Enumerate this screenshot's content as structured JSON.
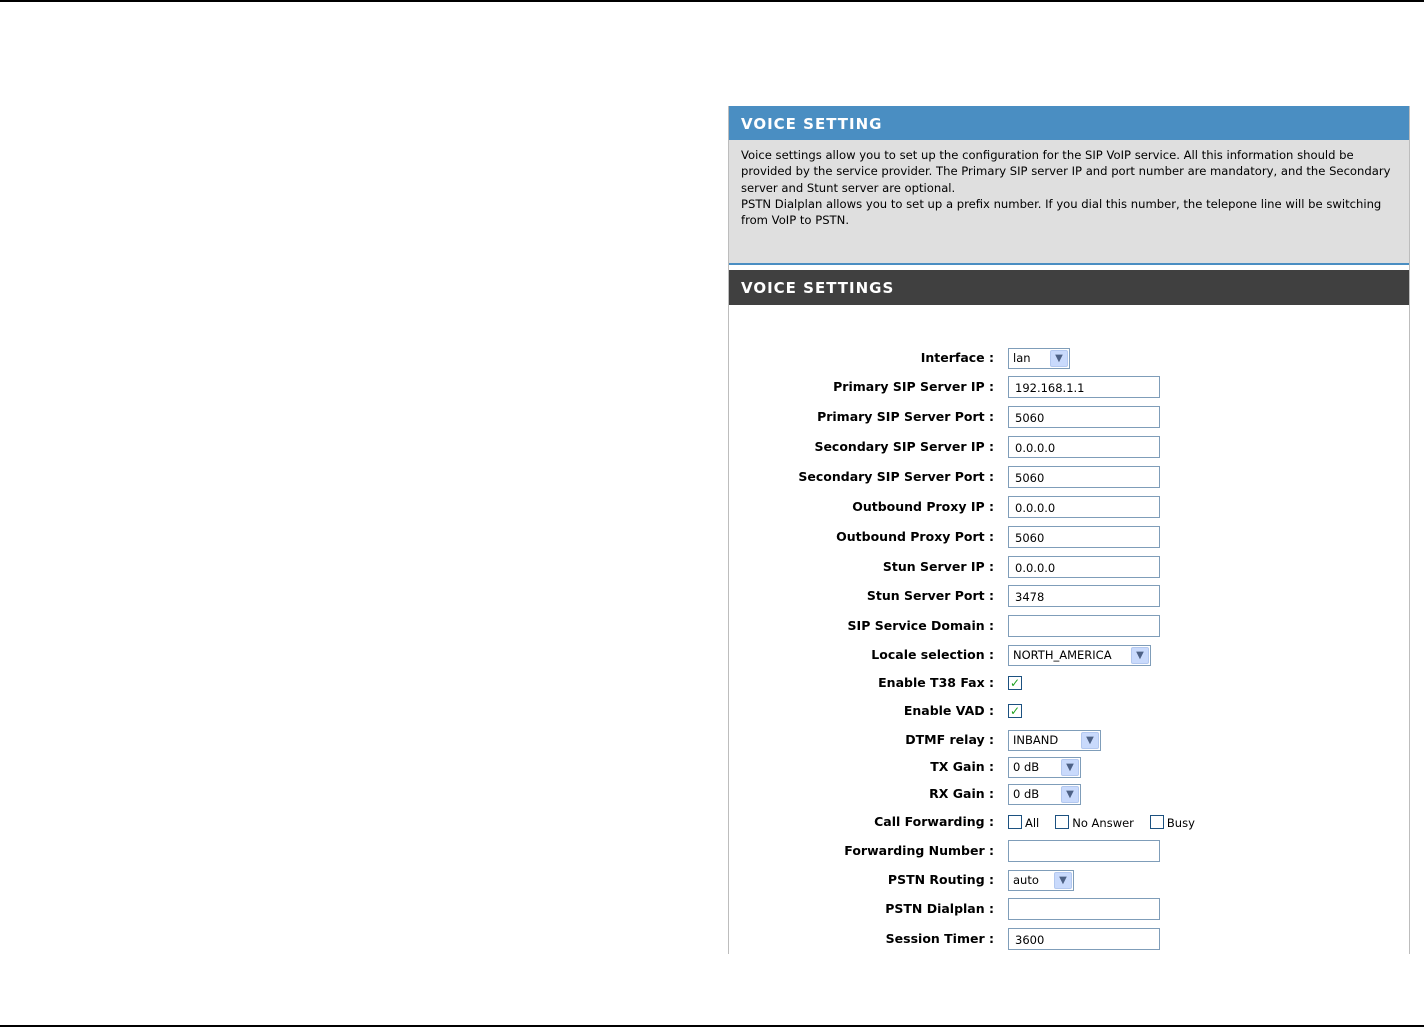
{
  "info": {
    "title": "VOICE SETTING",
    "description_1": "Voice settings allow you to set up the configuration for the SIP VoIP service. All this information should be provided by the service provider. The Primary SIP server IP and port number are mandatory, and the Secondary server and Stunt server are optional.",
    "description_2": "PSTN Dialplan allows you to set up a prefix number. If you dial this number, the telepone line will be switching from VoIP to PSTN."
  },
  "settings": {
    "title": "VOICE SETTINGS",
    "interface": {
      "label": "Interface :",
      "value": "lan"
    },
    "primary_sip_ip": {
      "label": "Primary SIP Server IP :",
      "value": "192.168.1.1"
    },
    "primary_sip_port": {
      "label": "Primary SIP Server Port :",
      "value": "5060"
    },
    "secondary_sip_ip": {
      "label": "Secondary SIP Server IP :",
      "value": "0.0.0.0"
    },
    "secondary_sip_port": {
      "label": "Secondary SIP Server Port :",
      "value": "5060"
    },
    "outbound_proxy_ip": {
      "label": "Outbound Proxy IP :",
      "value": "0.0.0.0"
    },
    "outbound_proxy_port": {
      "label": "Outbound Proxy Port :",
      "value": "5060"
    },
    "stun_server_ip": {
      "label": "Stun Server IP :",
      "value": "0.0.0.0"
    },
    "stun_server_port": {
      "label": "Stun Server Port :",
      "value": "3478"
    },
    "sip_service_domain": {
      "label": "SIP Service Domain :",
      "value": ""
    },
    "locale_selection": {
      "label": "Locale selection :",
      "value": "NORTH_AMERICA"
    },
    "enable_t38_fax": {
      "label": "Enable T38 Fax :",
      "checked": true
    },
    "enable_vad": {
      "label": "Enable VAD :",
      "checked": true
    },
    "dtmf_relay": {
      "label": "DTMF relay :",
      "value": "INBAND"
    },
    "tx_gain": {
      "label": "TX Gain :",
      "value": "0 dB"
    },
    "rx_gain": {
      "label": "RX Gain :",
      "value": "0 dB"
    },
    "call_forwarding": {
      "label": "Call Forwarding :",
      "options": [
        {
          "label": "All",
          "checked": false
        },
        {
          "label": "No Answer",
          "checked": false
        },
        {
          "label": "Busy",
          "checked": false
        }
      ]
    },
    "forwarding_number": {
      "label": "Forwarding Number :",
      "value": ""
    },
    "pstn_routing": {
      "label": "PSTN Routing :",
      "value": "auto"
    },
    "pstn_dialplan": {
      "label": "PSTN Dialplan :",
      "value": ""
    },
    "session_timer": {
      "label": "Session Timer :",
      "value": "3600"
    }
  },
  "icons": {
    "dropdown_arrow": "chevron-down-icon",
    "checkmark": "check-icon"
  }
}
